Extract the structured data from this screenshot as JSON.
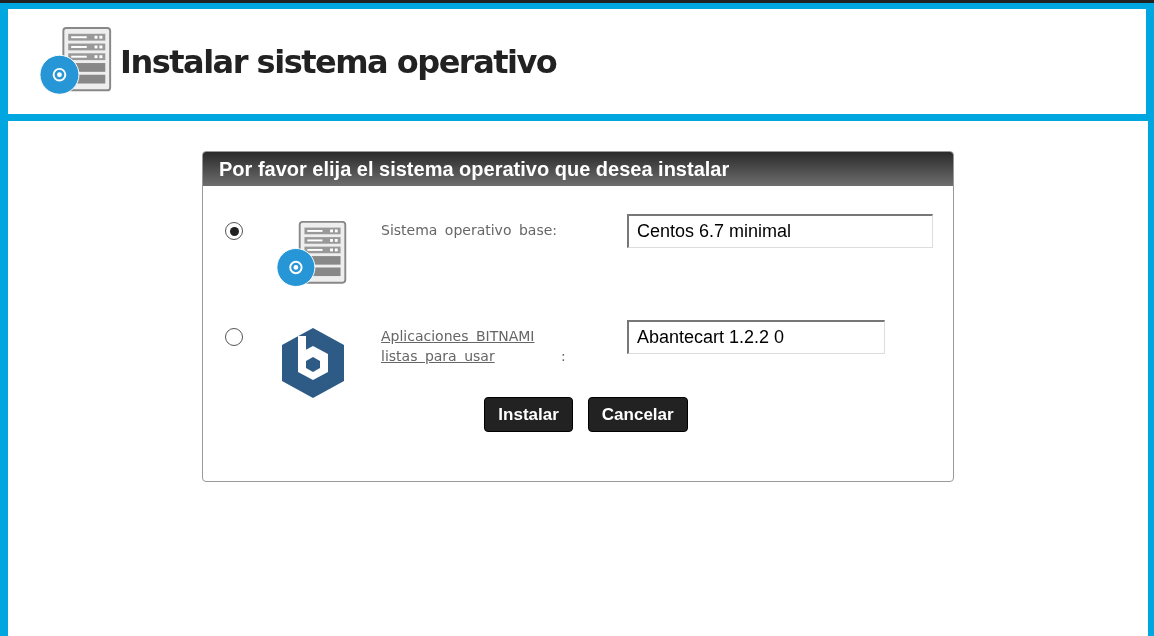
{
  "header": {
    "title": "Instalar sistema operativo"
  },
  "dialog": {
    "title": "Por favor elija el sistema operativo que desea instalar",
    "options": [
      {
        "kind": "base",
        "selected": true,
        "label": "Sistema operativo base:",
        "value": "Centos 6.7 minimal"
      },
      {
        "kind": "bitnami",
        "selected": false,
        "label": "Aplicaciones BITNAMI listas para usar",
        "suffix": ":",
        "value": "Abantecart 1.2.2 0"
      }
    ],
    "buttons": [
      "Instalar",
      "Cancelar"
    ]
  }
}
